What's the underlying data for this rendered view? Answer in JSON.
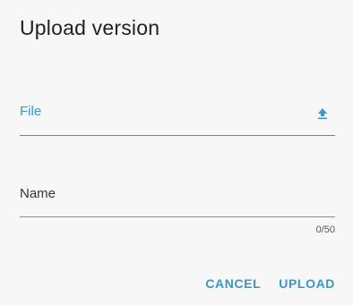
{
  "dialog": {
    "title": "Upload version",
    "file_field": {
      "label": "File",
      "icon": "upload-icon"
    },
    "name_field": {
      "label": "Name",
      "value": "",
      "counter": "0/50"
    },
    "actions": {
      "cancel_label": "CANCEL",
      "upload_label": "UPLOAD"
    },
    "colors": {
      "accent": "#3a96c8",
      "background": "#f7f7f7"
    }
  }
}
